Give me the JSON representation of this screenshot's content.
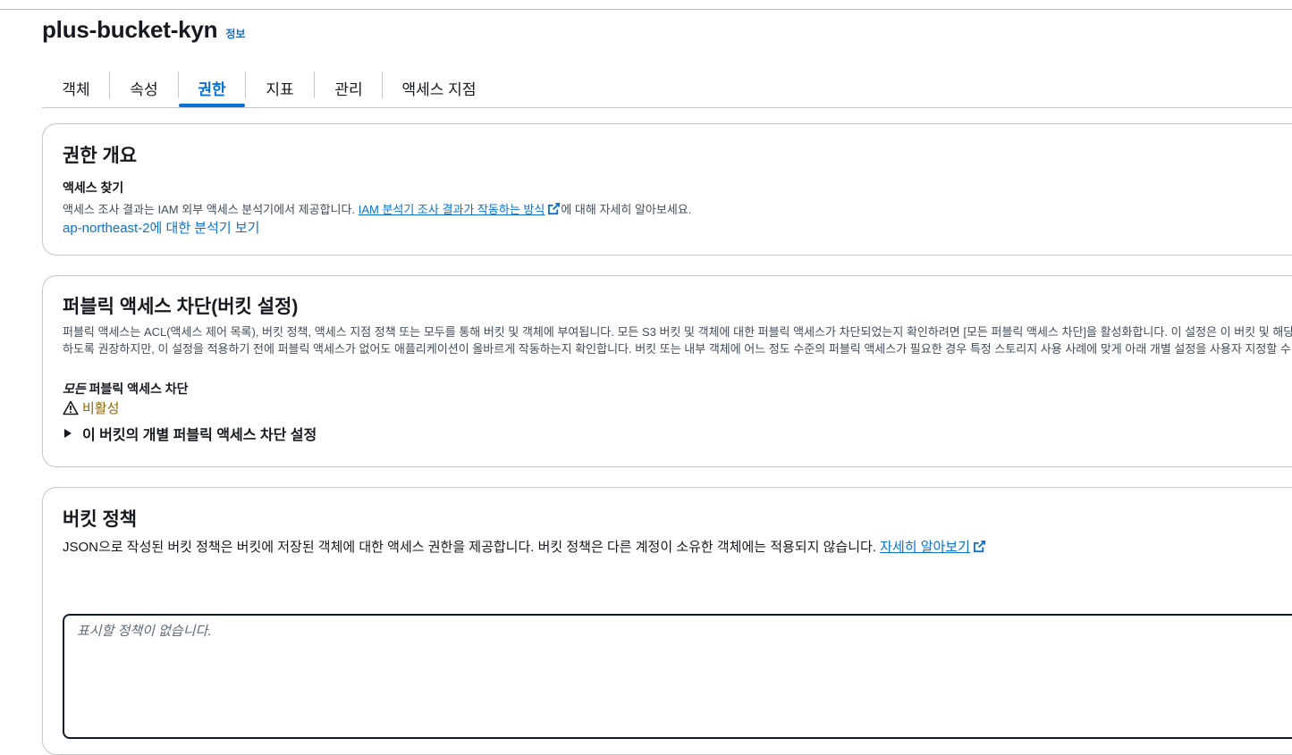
{
  "bucket": {
    "name": "plus-bucket-kyn",
    "info_label": "정보"
  },
  "tabs": [
    {
      "label": "객체"
    },
    {
      "label": "속성"
    },
    {
      "label": "권한",
      "active": true
    },
    {
      "label": "지표"
    },
    {
      "label": "관리"
    },
    {
      "label": "액세스 지점"
    }
  ],
  "overview": {
    "title": "권한 개요",
    "access_heading": "액세스 찾기",
    "desc_prefix": "액세스 조사 결과는 IAM 외부 액세스 분석기에서 제공합니다.",
    "desc_link": "IAM 분석기 조사 결과가 작동하는 방식",
    "desc_suffix": "에 대해 자세히 알아보세요.",
    "analyzer_link": "ap-northeast-2에 대한 분석기 보기"
  },
  "block_public": {
    "title": "퍼블릭 액세스 차단(버킷 설정)",
    "desc_line1": "퍼블릭 액세스는 ACL(액세스 제어 목록), 버킷 정책, 액세스 지점 정책 또는 모두를 통해 버킷 및 객체에 부여됩니다. 모든 S3 버킷 및 객체에 대한 퍼블릭 액세스가 차단되었는지 확인하려면 [모든 퍼블릭 액세스 차단]을 활성화합니다. 이 설정은 이 버킷 및 해당 액세스 지",
    "desc_line2": "하도록 권장하지만, 이 설정을 적용하기 전에 퍼블릭 액세스가 없어도 애플리케이션이 올바르게 작동하는지 확인합니다. 버킷 또는 내부 객체에 어느 정도 수준의 퍼블릭 액세스가 필요한 경우 특정 스토리지 사용 사례에 맞게 아래 개별 설정을 사용자 지정할 수 있습니다.",
    "all_block_em": "모든",
    "all_block_rest": " 퍼블릭 액세스 차단",
    "status": "비활성",
    "status_color": "#8d6605",
    "expander": "이 버킷의 개별 퍼블릭 액세스 차단 설정"
  },
  "bucket_policy": {
    "title": "버킷 정책",
    "desc": "JSON으로 작성된 버킷 정책은 버킷에 저장된 객체에 대한 액세스 권한을 제공합니다. 버킷 정책은 다른 계정이 소유한 객체에는 적용되지 않습니다.",
    "learn_more": "자세히 알아보기",
    "empty_text": "표시할 정책이 없습니다."
  },
  "colors": {
    "link": "#0972d3",
    "text": "#16191f",
    "warning": "#8d6605"
  }
}
